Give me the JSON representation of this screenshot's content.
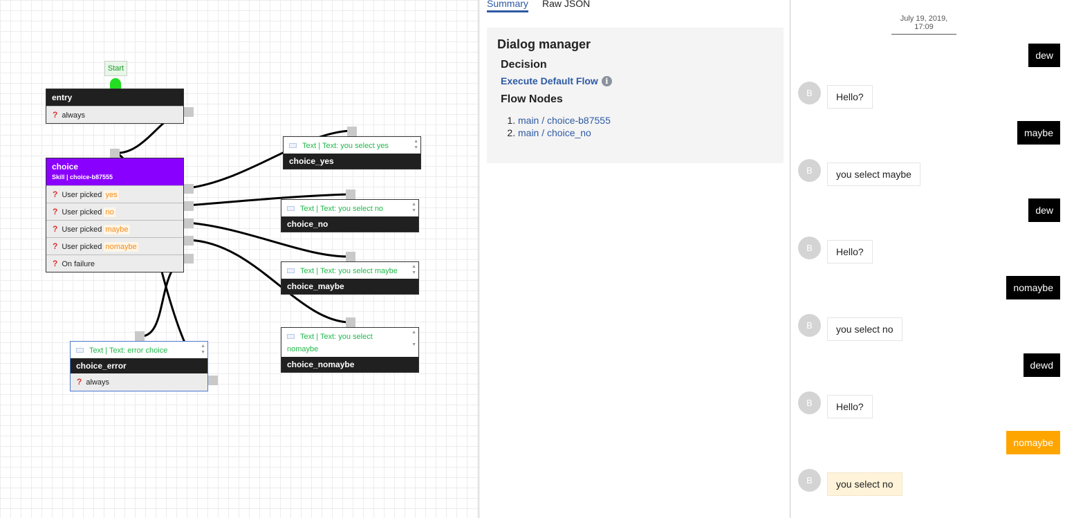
{
  "canvas": {
    "start_label": "Start",
    "entry_node": {
      "name": "entry",
      "transitions": [
        {
          "text": "always",
          "condition": ""
        }
      ]
    },
    "choice_node": {
      "name": "choice",
      "subtitle": "Skill | choice-b87555",
      "transitions": [
        {
          "text": "User picked",
          "condition": "yes"
        },
        {
          "text": "User picked",
          "condition": "no"
        },
        {
          "text": "User picked",
          "condition": "maybe"
        },
        {
          "text": "User picked",
          "condition": "nomaybe"
        },
        {
          "text": "On failure",
          "condition": ""
        }
      ]
    },
    "text_nodes": [
      {
        "name": "choice_yes",
        "content": "Text | Text: you select yes"
      },
      {
        "name": "choice_no",
        "content": "Text | Text: you select no"
      },
      {
        "name": "choice_maybe",
        "content": "Text | Text: you select maybe"
      },
      {
        "name": "choice_nomaybe",
        "content_line1": "Text | Text: you select",
        "content_line2": "nomaybe"
      },
      {
        "name": "choice_error",
        "content": "Text | Text: error choice",
        "transition": "always"
      }
    ],
    "transition_icon": "question-icon",
    "text_icon": "message-icon"
  },
  "inspector": {
    "tabs": [
      {
        "label": "Summary",
        "active": true
      },
      {
        "label": "Raw JSON",
        "active": false
      }
    ],
    "title": "Dialog manager",
    "decision_heading": "Decision",
    "decision_value": "Execute Default Flow",
    "flow_nodes_heading": "Flow Nodes",
    "flow_nodes": [
      "main / choice-b87555",
      "main / choice_no"
    ]
  },
  "chat": {
    "date": "July 19, 2019, 17:09",
    "bot_avatar": "B",
    "messages": [
      {
        "from": "user",
        "text": "dew"
      },
      {
        "from": "bot",
        "text": "Hello?"
      },
      {
        "from": "user",
        "text": "maybe"
      },
      {
        "from": "bot",
        "text": "you select maybe"
      },
      {
        "from": "user",
        "text": "dew"
      },
      {
        "from": "bot",
        "text": "Hello?"
      },
      {
        "from": "user",
        "text": "nomaybe"
      },
      {
        "from": "bot",
        "text": "you select no"
      },
      {
        "from": "user",
        "text": "dewd"
      },
      {
        "from": "bot",
        "text": "Hello?"
      },
      {
        "from": "user",
        "text": "nomaybe",
        "highlighted": true
      },
      {
        "from": "bot",
        "text": "you select no",
        "highlighted": true
      }
    ]
  },
  "colors": {
    "skill_header": "#8a00ff",
    "start_dot": "#22dd22",
    "condition_text": "#f28c1a",
    "text_node_content": "#20b84a",
    "link": "#2d5aa3",
    "highlight_user": "#ffa500",
    "highlight_bot": "#fff3d9"
  }
}
